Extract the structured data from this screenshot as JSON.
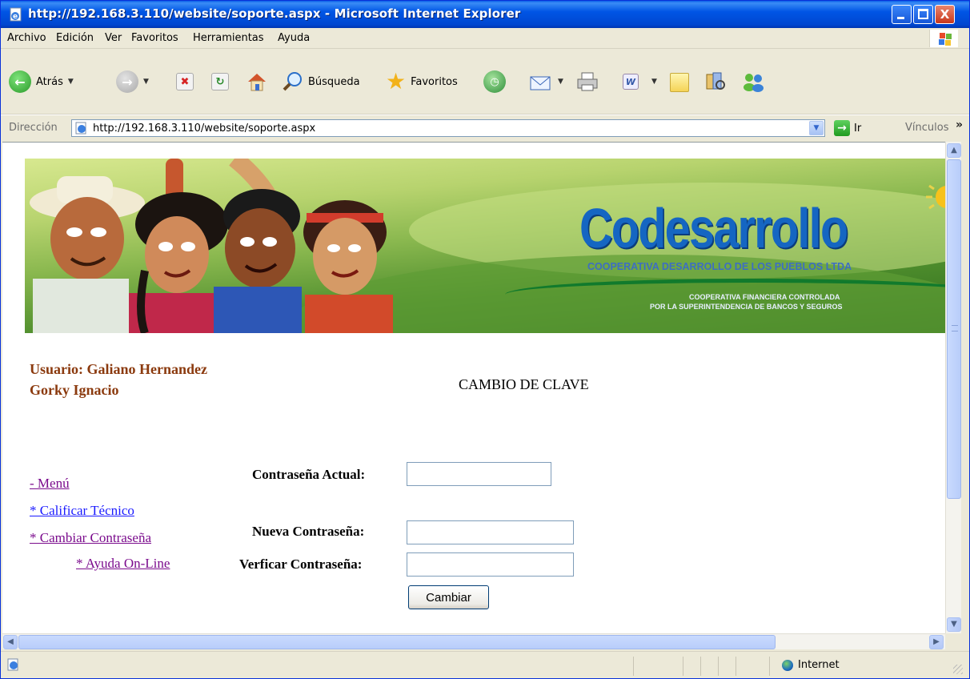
{
  "window": {
    "title": "http://192.168.3.110/website/soporte.aspx - Microsoft Internet Explorer",
    "controls": {
      "minimize": "",
      "maximize": "",
      "close": "X"
    }
  },
  "menu": [
    "Archivo",
    "Edición",
    "Ver",
    "Favoritos",
    "Herramientas",
    "Ayuda"
  ],
  "toolbar": {
    "back_label": "Atrás",
    "search_label": "Búsqueda",
    "favorites_label": "Favoritos"
  },
  "address": {
    "label": "Dirección",
    "url": "http://192.168.3.110/website/soporte.aspx",
    "go_label": "Ir",
    "links_label": "Vínculos",
    "more_glyph": "»"
  },
  "banner": {
    "logo_text": "Codesarrollo",
    "tagline": "COOPERATIVA DESARROLLO DE LOS PUEBLOS LTDA",
    "sub_line1": "COOPERATIVA FINANCIERA CONTROLADA",
    "sub_line2": "POR LA SUPERINTENDENCIA DE BANCOS Y SEGUROS"
  },
  "page": {
    "user_text": "Usuario: Galiano Hernandez Gorky Ignacio",
    "heading": "CAMBIO DE CLAVE",
    "links": {
      "menu": "- Menú",
      "calificar": "* Calificar Técnico",
      "cambiar": "* Cambiar Contraseña",
      "ayuda": "* Ayuda On-Line"
    },
    "form": {
      "current_label": "Contraseña Actual:",
      "current_value": "",
      "new_label": "Nueva Contraseña:",
      "new_value": "",
      "verify_label": "Verficar Contraseña:",
      "verify_value": "",
      "submit_label": "Cambiar"
    }
  },
  "status": {
    "zone_label": "Internet"
  },
  "colors": {
    "titlebar": "#0055e5",
    "user_text": "#8b3a0e",
    "visited_link": "#7b0c8d",
    "unvisited_link": "#1a1aff",
    "logo": "#1566c2"
  }
}
